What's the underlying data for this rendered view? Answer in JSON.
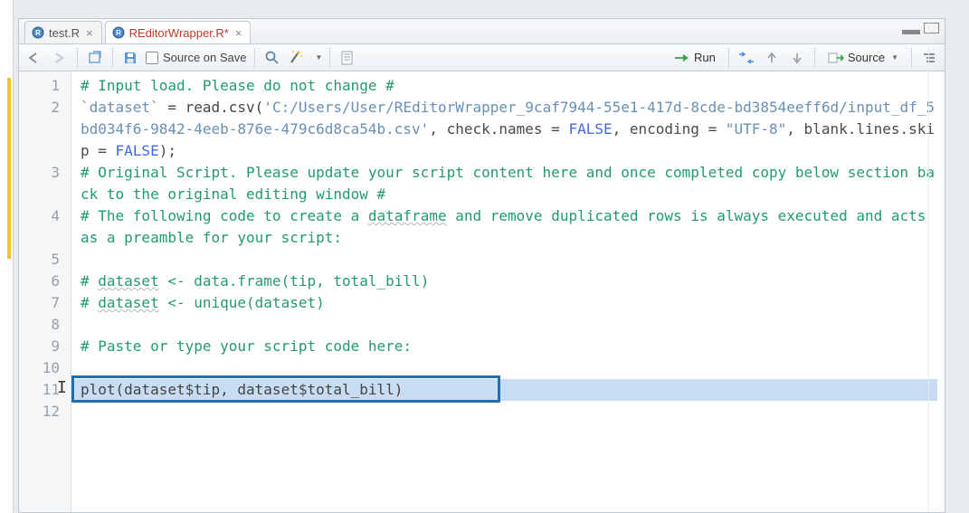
{
  "tabs": [
    {
      "file_icon": "R",
      "label": "test.R",
      "dirty": false
    },
    {
      "file_icon": "R",
      "label": "REditorWrapper.R*",
      "dirty": true
    }
  ],
  "toolbar": {
    "source_on_save_label": "Source on Save",
    "run_label": "Run",
    "source_label": "Source"
  },
  "code": {
    "lines": [
      {
        "n": "1",
        "h": 1,
        "segments": [
          {
            "c": "comment",
            "t": "# Input load. Please do not change #"
          }
        ]
      },
      {
        "n": "2",
        "h": 3,
        "segments": [
          {
            "c": "string",
            "t": "`dataset`"
          },
          {
            "c": "op",
            "t": " = "
          },
          {
            "c": "func",
            "t": "read.csv("
          },
          {
            "c": "string",
            "t": "'C:/Users/User/REditorWrapper_9caf7944-55e1-417d-8cde-bd3854eeff6d/input_df_5bd034f6-9842-4eeb-876e-479c6d8ca54b.csv'"
          },
          {
            "c": "op",
            "t": ", check.names = "
          },
          {
            "c": "const",
            "t": "FALSE"
          },
          {
            "c": "op",
            "t": ", encoding = "
          },
          {
            "c": "string",
            "t": "\"UTF-8\""
          },
          {
            "c": "op",
            "t": ", blank.lines.skip = "
          },
          {
            "c": "const",
            "t": "FALSE"
          },
          {
            "c": "op",
            "t": ");"
          }
        ]
      },
      {
        "n": "3",
        "h": 2,
        "segments": [
          {
            "c": "comment",
            "t": "# Original Script. Please update your script content here and once completed copy below section back to the original editing window #"
          }
        ]
      },
      {
        "n": "4",
        "h": 2,
        "segments": [
          {
            "c": "comment",
            "t": "# The following code to create a "
          },
          {
            "c": "comment wavy",
            "t": "dataframe"
          },
          {
            "c": "comment",
            "t": " and remove duplicated rows is always executed and acts as a preamble for your script:"
          }
        ]
      },
      {
        "n": "5",
        "h": 1,
        "segments": []
      },
      {
        "n": "6",
        "h": 1,
        "segments": [
          {
            "c": "comment",
            "t": "# "
          },
          {
            "c": "comment wavy",
            "t": "dataset"
          },
          {
            "c": "comment",
            "t": " <- data.frame(tip, total_bill)"
          }
        ]
      },
      {
        "n": "7",
        "h": 1,
        "segments": [
          {
            "c": "comment",
            "t": "# "
          },
          {
            "c": "comment wavy",
            "t": "dataset"
          },
          {
            "c": "comment",
            "t": " <- unique(dataset)"
          }
        ]
      },
      {
        "n": "8",
        "h": 1,
        "segments": []
      },
      {
        "n": "9",
        "h": 1,
        "segments": [
          {
            "c": "comment",
            "t": "# Paste or type your script code here:"
          }
        ]
      },
      {
        "n": "10",
        "h": 1,
        "segments": []
      },
      {
        "n": "11",
        "h": 1,
        "highlight": true,
        "box": true,
        "segments": [
          {
            "c": "func",
            "t": "plot(dataset"
          },
          {
            "c": "op",
            "t": "$"
          },
          {
            "c": "func",
            "t": "tip, dataset"
          },
          {
            "c": "op",
            "t": "$"
          },
          {
            "c": "func",
            "t": "total_bill)"
          }
        ]
      },
      {
        "n": "12",
        "h": 1,
        "segments": []
      }
    ]
  }
}
